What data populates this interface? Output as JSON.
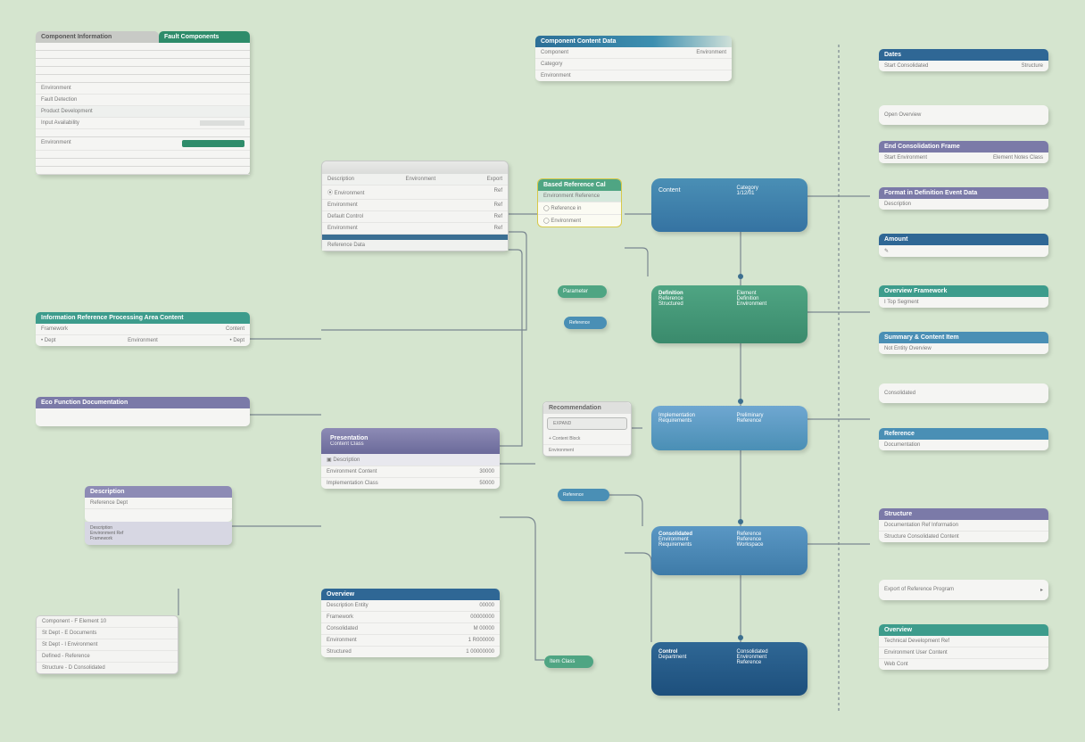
{
  "topLeft": {
    "title": "Component Information",
    "tab": "Fault Components",
    "rows": [
      "",
      "",
      "",
      "Environment",
      "Fault Detection",
      "Product Development",
      "Input Availability",
      "",
      "Environment"
    ]
  },
  "topCenter": {
    "title": "Component Content Data",
    "cols": [
      "Component",
      "Environment"
    ],
    "r1": "Category",
    "r2": "Environment"
  },
  "centerWin": {
    "tabs": [
      "Description",
      "Environment",
      "Export"
    ],
    "rows": [
      [
        "Environment",
        "Ref"
      ],
      [
        "Environment",
        "Ref"
      ],
      [
        "Default Control",
        "Ref"
      ],
      [
        "Environment",
        "Ref"
      ]
    ],
    "footer": "Reference Data"
  },
  "yellow": {
    "title": "Based Reference Cal",
    "r1": "Environment Reference",
    "r2": "Reference in",
    "r3": "Environment"
  },
  "blueBox1": {
    "l": "Content",
    "rT": "Category",
    "rB": "1/12/01"
  },
  "greenBox": {
    "title": "Definition",
    "l1": "Reference",
    "l2": "Structured",
    "r1": "Element",
    "r2": "Definition",
    "r3": "Environment"
  },
  "pill1": "Parameter",
  "pill2": "Reference",
  "blueBox2": {
    "title": "Recommendation",
    "l": "Implementation",
    "lb": "Requirements",
    "r": "Preliminary",
    "rb": "Reference"
  },
  "blueBox3": {
    "title": "Consolidated",
    "l1": "Environment",
    "l2": "Requirements",
    "r1": "Reference",
    "r2": "Reference",
    "r3": "Workspace"
  },
  "blueBox4": {
    "title": "Control",
    "l1": "Department",
    "l2": "",
    "r1": "Consolidated",
    "r2": "Environment",
    "r3": "Reference"
  },
  "pill3": "Item Class",
  "leftTable": {
    "title": "Information Reference Processing Area Content",
    "h": [
      "Framework",
      "",
      "Content",
      ""
    ],
    "r": [
      "Dept",
      "Environment",
      "Dept"
    ]
  },
  "leftPurple": {
    "title": "Eco Function Documentation"
  },
  "purpleBox": {
    "title": "Presentation",
    "sub": "Content Class",
    "rows": [
      [
        "Description",
        ""
      ],
      [
        "Environment Content",
        "30000"
      ],
      [
        "Implementation Class",
        "50000"
      ]
    ]
  },
  "purpleSmall": {
    "title": "Description",
    "l1": "Reference Dept",
    "l2": "",
    "ft": "Description",
    "fs": "Environment Ref",
    "ft2": "Framework"
  },
  "blueTable": {
    "title": "Overview",
    "rows": [
      [
        "Description Entity",
        "00000"
      ],
      [
        "Framework",
        "00000000"
      ],
      [
        "Consolidated",
        "M 00000"
      ],
      [
        "Environment",
        "1 R000000"
      ],
      [
        "Structured",
        "1 00000000"
      ]
    ]
  },
  "greyList": {
    "rows": [
      "Component - F Element 10",
      "St Dept - E Documents",
      "St Dept - I Environment",
      "Defined - Reference",
      "Structure - D Consolidated"
    ]
  },
  "rCol": {
    "c1": {
      "title": "Dates",
      "l": "Start Consolidated",
      "r": "Structure"
    },
    "c2": {
      "title": "Open Overview"
    },
    "c3": {
      "title": "End Consolidation Frame",
      "l": "Start Environment",
      "r": "Element Notes Class"
    },
    "c4": {
      "title": "Format in Definition Event Data",
      "b": "Description"
    },
    "c5": {
      "title": "Amount",
      "icon": "✎"
    },
    "c6": {
      "title": "Overview Framework",
      "b": "I Top Segment"
    },
    "c7": {
      "title": "Summary & Content Item",
      "b": "Not Entity Overview"
    },
    "c8": {
      "title": "Consolidated"
    },
    "c9": {
      "title": "Reference",
      "b": "Documentation"
    },
    "c10": {
      "title": "Structure",
      "l1": "Documentation Ref Information",
      "l2": "Structure Consolidated Content"
    },
    "c11": {
      "b": "Export of Reference Program",
      "arrow": "▸"
    },
    "c12": {
      "title": "Overview",
      "l1": "Technical Development Ref",
      "l2": "Environment User Content",
      "l3": "Web Cont"
    }
  }
}
